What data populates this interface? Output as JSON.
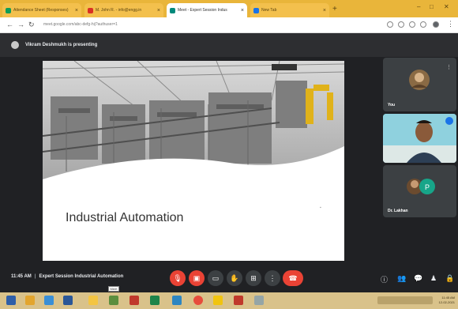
{
  "browser": {
    "tabs": [
      {
        "title": "Attendance Sheet (Responses)",
        "active": false,
        "favicon_color": "#0f9d58"
      },
      {
        "title": "M. John R. - info@engg.in",
        "active": false,
        "favicon_color": "#d93025"
      },
      {
        "title": "Meet - Expert Session Indus",
        "active": true,
        "favicon_color": "#00897b"
      },
      {
        "title": "New Tab",
        "active": false,
        "favicon_color": "#1a73e8"
      }
    ],
    "new_tab_label": "+",
    "url": "meet.google.com/abc-defg-hij?authuser=1"
  },
  "meet": {
    "presenting_text": "Vikram Deshmukh is presenting",
    "slide_title": "Industrial Automation",
    "participants": [
      {
        "name": "You",
        "kind": "avatar"
      },
      {
        "name": "",
        "kind": "video"
      },
      {
        "name": "Dr. Lakhan",
        "kind": "avatar-badge"
      }
    ],
    "time": "11:45 AM",
    "meeting_name": "Expert Session Industrial Automation",
    "controls": {
      "mic": "microphone-off-icon",
      "camera": "camera-off-icon",
      "captions": "captions-icon",
      "raise_hand": "hand-icon",
      "present": "present-icon",
      "more": "more-icon",
      "hangup": "hangup-icon"
    }
  },
  "taskbar": {
    "tooltip": "Meet",
    "clock_time": "11:45 AM",
    "clock_date": "12-02-2021"
  },
  "colors": {
    "accent_red": "#ea4335",
    "meet_bg": "#202124",
    "tab_bar": "#e9b53a",
    "taskbar": "#d9c28a"
  }
}
